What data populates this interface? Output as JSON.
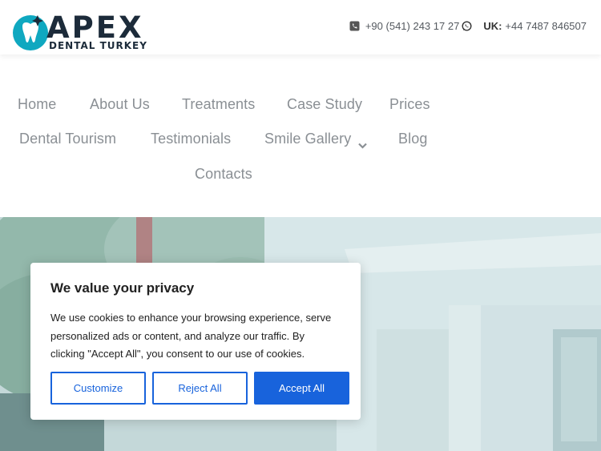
{
  "brand": {
    "name": "APEX",
    "tagline": "DENTAL TURKEY",
    "primary_color": "#0fa8c0",
    "dark_color": "#1c2b3a"
  },
  "contact": {
    "turkey_number": "+90 (541) 243 17 27",
    "uk_label": "UK:",
    "uk_number": "+44 7487 846507",
    "phone_icon": "phone-square-icon",
    "whatsapp_icon": "whatsapp-icon"
  },
  "nav": {
    "items": [
      {
        "label": "Home"
      },
      {
        "label": "About Us"
      },
      {
        "label": "Treatments"
      },
      {
        "label": "Case Study"
      },
      {
        "label": "Prices"
      },
      {
        "label": "Dental Tourism"
      },
      {
        "label": "Testimonials"
      },
      {
        "label": "Smile Gallery"
      },
      {
        "label": "Blog"
      },
      {
        "label": "Contacts"
      }
    ],
    "text_color": "#8a8f94"
  },
  "cookie": {
    "title": "We value your privacy",
    "body": "We use cookies to enhance your browsing experience, serve personalized ads or content, and analyze our traffic. By clicking \"Accept All\", you consent to our use of cookies.",
    "customize_label": "Customize",
    "reject_label": "Reject All",
    "accept_label": "Accept All",
    "accent_color": "#1863dc"
  }
}
